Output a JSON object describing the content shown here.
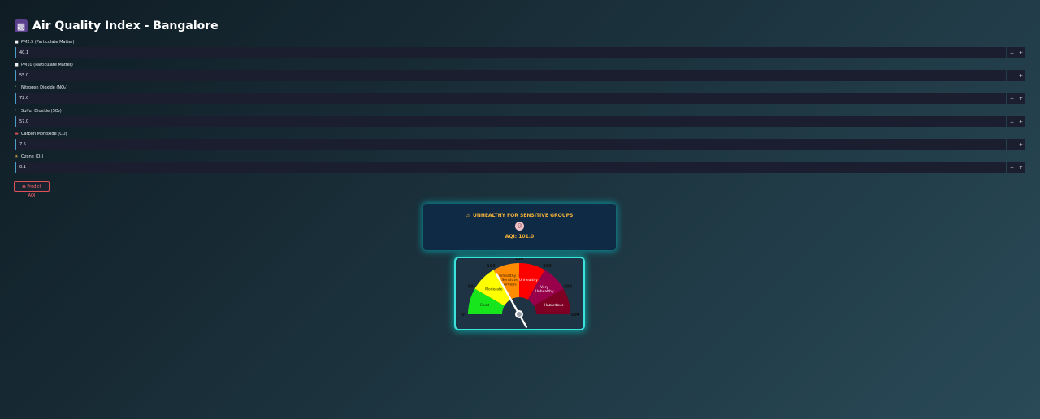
{
  "app": {
    "icon": "cityscape-icon",
    "title": "Air Quality Index - Bangalore"
  },
  "fields": [
    {
      "icon": "white-square-icon",
      "label": "PM2.5 (Particulate Matter)",
      "value": "40.1"
    },
    {
      "icon": "white-square-icon",
      "label": "PM10 (Particulate Matter)",
      "value": "55.0"
    },
    {
      "icon": "test-tube-icon",
      "label": "Nitrogen Dioxide (NO₂)",
      "value": "72.0"
    },
    {
      "icon": "test-tube-icon",
      "label": "Sulfur Dioxide (SO₂)",
      "value": "57.0"
    },
    {
      "icon": "car-icon",
      "label": "Carbon Monoxide (CO)",
      "value": "7.5"
    },
    {
      "icon": "sun-cloud-icon",
      "label": "Ozone (O₃)",
      "value": "0.1"
    }
  ],
  "stepper": {
    "minus": "−",
    "plus": "+"
  },
  "predict_button": {
    "icon": "mask-icon",
    "label": "Predict AQI"
  },
  "result": {
    "icon": "warning-icon",
    "status": "UNHEALTHY FOR SENSITIVE GROUPS",
    "emoji_icon": "sick-face-icon",
    "aqi_text": "AQI: 101.0",
    "status_color": "#f3b23a"
  },
  "gauge": {
    "value": 101.0,
    "min": 0,
    "max": 500,
    "ticks": [
      "0",
      "50",
      "100",
      "150",
      "200",
      "300",
      "500"
    ],
    "bands": [
      {
        "label": "Good",
        "color": "#18e61c",
        "label_color": "#1a3a10"
      },
      {
        "label": "Moderate",
        "color": "#ffff00",
        "label_color": "#333300"
      },
      {
        "label": "Unhealthy for Sensitive Groups",
        "color": "#ff8c00",
        "label_color": "#3a1e00"
      },
      {
        "label": "Unhealthy",
        "color": "#ff0000",
        "label_color": "#ffffff"
      },
      {
        "label": "Very Unhealthy",
        "color": "#99004c",
        "label_color": "#ffffff"
      },
      {
        "label": "Hazardous",
        "color": "#7e0023",
        "label_color": "#ffffff"
      }
    ]
  }
}
